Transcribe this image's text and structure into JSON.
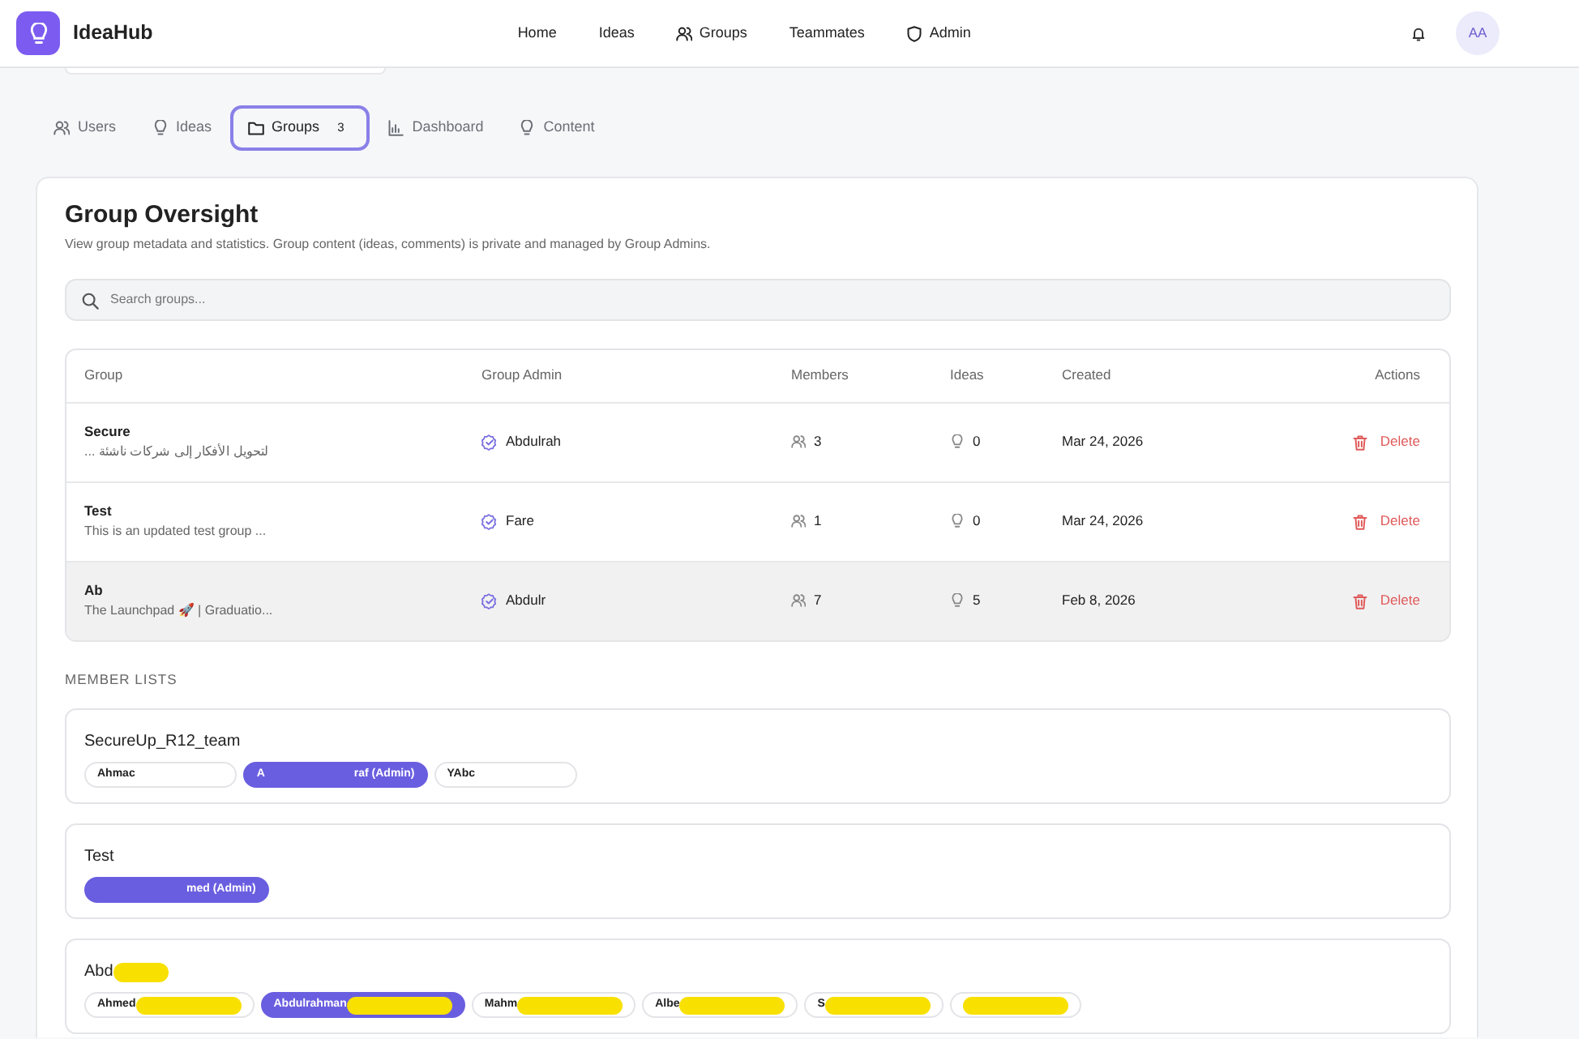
{
  "brand": {
    "name": "IdeaHub"
  },
  "nav": [
    {
      "label": "Home"
    },
    {
      "label": "Ideas"
    },
    {
      "label": "Groups"
    },
    {
      "label": "Teammates"
    },
    {
      "label": "Admin"
    }
  ],
  "user": {
    "initials": "AA"
  },
  "tabs": [
    {
      "label": "Users",
      "selected": false
    },
    {
      "label": "Ideas",
      "selected": false
    },
    {
      "label": "Groups",
      "selected": true,
      "count": "3"
    },
    {
      "label": "Dashboard",
      "selected": false
    },
    {
      "label": "Content",
      "selected": false
    }
  ],
  "panel": {
    "title": "Group Oversight",
    "subtitle": "View group metadata and statistics. Group content (ideas, comments) is private and managed by Group Admins.",
    "search": {
      "placeholder": "Search groups..."
    }
  },
  "table": {
    "columns": [
      "Group",
      "Group Admin",
      "Members",
      "Ideas",
      "Created",
      "Actions"
    ],
    "rows": [
      {
        "name": "Secure",
        "description": "لتحويل الأفكار إلى شركات ناشئة ...",
        "admin": "Abdulrah",
        "members": "3",
        "ideas": "0",
        "created": "Mar 24, 2026",
        "action": "Delete",
        "highlighted": false
      },
      {
        "name": "Test",
        "description": "This is an updated test group ...",
        "admin": "Fare",
        "members": "1",
        "ideas": "0",
        "created": "Mar 24, 2026",
        "action": "Delete",
        "highlighted": false
      },
      {
        "name": "Ab",
        "description": "The Launchpad 🚀 | Graduatio...",
        "admin": "Abdulr",
        "members": "7",
        "ideas": "5",
        "created": "Feb 8, 2026",
        "action": "Delete",
        "highlighted": true
      }
    ]
  },
  "member_lists": {
    "heading": "MEMBER LISTS",
    "groups": [
      {
        "name": "SecureUp_R12_team",
        "kind": "blanked",
        "members": [
          {
            "label": "Ahmac",
            "admin": false
          },
          {
            "label": "A",
            "label_after": "raf (Admin)",
            "admin": true
          },
          {
            "label": "YAbc",
            "admin": false
          }
        ]
      },
      {
        "name": "Test",
        "kind": "blanked",
        "members": [
          {
            "label_after": "med (Admin)",
            "admin": true
          }
        ]
      },
      {
        "name": "Abd",
        "kind": "scribbled",
        "members": [
          {
            "label": "Ahmed",
            "admin": false
          },
          {
            "label": "Abdulrahman",
            "admin": true
          },
          {
            "label": "Mahm",
            "admin": false
          },
          {
            "label": "Albe",
            "admin": false
          },
          {
            "label": "S",
            "admin": false
          },
          {
            "admin": false
          }
        ]
      }
    ]
  }
}
